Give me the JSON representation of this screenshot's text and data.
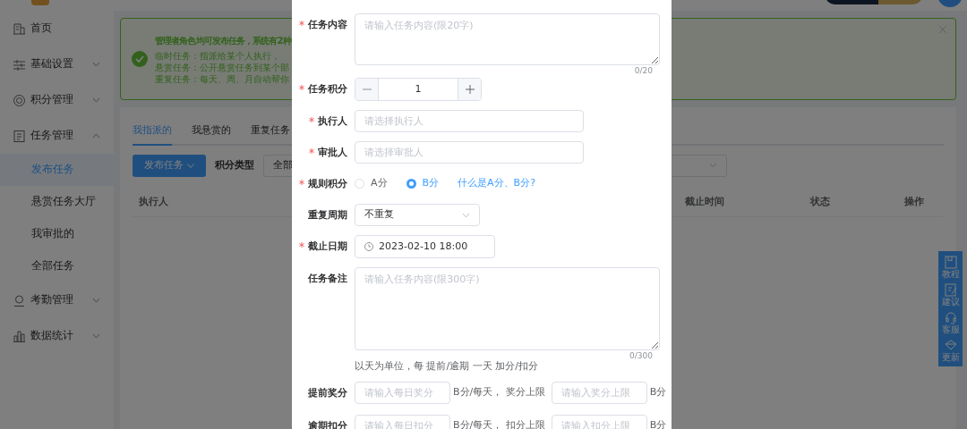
{
  "sidebar": {
    "items": [
      {
        "label": "首页",
        "kind": "link"
      },
      {
        "label": "基础设置",
        "kind": "group",
        "expanded": false
      },
      {
        "label": "积分管理",
        "kind": "group",
        "expanded": false
      },
      {
        "label": "任务管理",
        "kind": "group",
        "expanded": true,
        "children": [
          {
            "label": "发布任务",
            "selected": true
          },
          {
            "label": "悬赏任务大厅",
            "selected": false
          },
          {
            "label": "我审批的",
            "selected": false
          },
          {
            "label": "全部任务",
            "selected": false
          }
        ]
      },
      {
        "label": "考勤管理",
        "kind": "group",
        "expanded": false
      },
      {
        "label": "数据统计",
        "kind": "group",
        "expanded": false
      }
    ]
  },
  "alert": {
    "title": "管理者角色均可发布任务，系统有2种",
    "lines": [
      "临时任务：指派给某个人执行，",
      "悬赏任务：公开悬赏任务到某个部",
      "重复任务：每天、周、月自动帮你"
    ]
  },
  "tabs": [
    {
      "label": "我指派的",
      "selected": true
    },
    {
      "label": "我悬赏的",
      "selected": false
    },
    {
      "label": "重复任务",
      "selected": false
    }
  ],
  "toolbar": {
    "button": "发布任务",
    "filter_label": "积分类型",
    "filter_value": "全部"
  },
  "table": {
    "columns": [
      "执行人",
      "截止时间",
      "状态",
      "操作"
    ]
  },
  "side_tools": [
    {
      "label": "教程"
    },
    {
      "label": "建议"
    },
    {
      "label": "客服"
    },
    {
      "label": "更新"
    }
  ],
  "modal": {
    "fields": [
      {
        "kind": "short_text",
        "label": "任务内容",
        "required": true,
        "placeholder": "请输入任务内容(限20字)",
        "counter": "0/20"
      },
      {
        "kind": "stepper",
        "label": "任务积分",
        "required": true,
        "value": "1"
      },
      {
        "kind": "select",
        "label": "执行人",
        "required": true,
        "placeholder": "请选择执行人"
      },
      {
        "kind": "select",
        "label": "审批人",
        "required": true,
        "placeholder": "请选择审批人"
      },
      {
        "kind": "radio",
        "label": "规则积分",
        "required": true,
        "options": [
          {
            "label": "A分",
            "selected": false
          },
          {
            "label": "B分",
            "selected": true
          }
        ],
        "link": "什么是A分、B分?"
      },
      {
        "kind": "dropdown",
        "label": "重复周期",
        "required": false,
        "value": "不重复"
      },
      {
        "kind": "date",
        "label": "截止日期",
        "required": true,
        "value": "2023-02-10 18:00"
      },
      {
        "kind": "long_text",
        "label": "任务备注",
        "required": false,
        "placeholder": "请输入任务内容(限300字)",
        "counter": "0/300"
      },
      {
        "kind": "hint",
        "text": "以天为单位，每 提前/逾期 一天 加分/扣分"
      },
      {
        "kind": "range",
        "label": "提前奖分",
        "required": false,
        "placeholder_1": "请输入每日奖分",
        "middle": "B分/每天， 奖分上限",
        "placeholder_2": "请输入奖分上限",
        "unit": "B分"
      },
      {
        "kind": "range",
        "label": "逾期扣分",
        "required": false,
        "placeholder_1": "请输入每日扣分",
        "middle": "B分/每天， 扣分上限",
        "placeholder_2": "请输入扣分上限",
        "unit": "B分"
      }
    ]
  }
}
